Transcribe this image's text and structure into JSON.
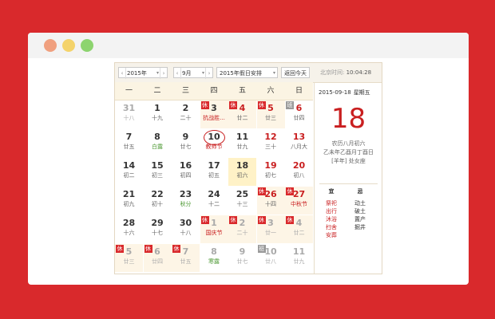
{
  "toolbar": {
    "prev_arrow": "‹",
    "next_arrow": "›",
    "year": "2015年",
    "month": "9月",
    "holiday": "2015年假日安排",
    "today_button": "返回今天",
    "clock_label": "北京时间:",
    "clock_time": "10:04:28",
    "dropdown_arrow": "▾"
  },
  "weekdays": [
    "一",
    "二",
    "三",
    "四",
    "五",
    "六",
    "日"
  ],
  "weeks": [
    [
      {
        "d": "31",
        "l": "十八",
        "other": true
      },
      {
        "d": "1",
        "l": "十九"
      },
      {
        "d": "2",
        "l": "二十"
      },
      {
        "d": "3",
        "l": "抗战胜...",
        "badge": "休",
        "red": true,
        "hol": true
      },
      {
        "d": "4",
        "l": "廿二",
        "badge": "休",
        "hol": true,
        "wkd": true
      },
      {
        "d": "5",
        "l": "廿三",
        "badge": "休",
        "hol": true,
        "wkd": true
      },
      {
        "d": "6",
        "l": "廿四",
        "badge": "班",
        "wkd": true
      }
    ],
    [
      {
        "d": "7",
        "l": "廿五"
      },
      {
        "d": "8",
        "l": "白露",
        "green": true
      },
      {
        "d": "9",
        "l": "廿七"
      },
      {
        "d": "10",
        "l": "教师节",
        "red": true,
        "ring": true
      },
      {
        "d": "11",
        "l": "廿九"
      },
      {
        "d": "12",
        "l": "三十",
        "wkd": true
      },
      {
        "d": "13",
        "l": "八月大",
        "wkd": true
      }
    ],
    [
      {
        "d": "14",
        "l": "初二"
      },
      {
        "d": "15",
        "l": "初三"
      },
      {
        "d": "16",
        "l": "初四"
      },
      {
        "d": "17",
        "l": "初五"
      },
      {
        "d": "18",
        "l": "初六",
        "sel": true
      },
      {
        "d": "19",
        "l": "初七",
        "wkd": true
      },
      {
        "d": "20",
        "l": "初八",
        "wkd": true
      }
    ],
    [
      {
        "d": "21",
        "l": "初九"
      },
      {
        "d": "22",
        "l": "初十"
      },
      {
        "d": "23",
        "l": "秋分",
        "green": true
      },
      {
        "d": "24",
        "l": "十二"
      },
      {
        "d": "25",
        "l": "十三"
      },
      {
        "d": "26",
        "l": "十四",
        "badge": "休",
        "hol": true,
        "wkd": true
      },
      {
        "d": "27",
        "l": "中秋节",
        "badge": "休",
        "hol": true,
        "wkd": true,
        "red": true
      }
    ],
    [
      {
        "d": "28",
        "l": "十六"
      },
      {
        "d": "29",
        "l": "十七"
      },
      {
        "d": "30",
        "l": "十八"
      },
      {
        "d": "1",
        "l": "国庆节",
        "badge": "休",
        "hol": true,
        "other": true,
        "red": true
      },
      {
        "d": "2",
        "l": "二十",
        "badge": "休",
        "hol": true,
        "other": true
      },
      {
        "d": "3",
        "l": "廿一",
        "badge": "休",
        "hol": true,
        "other": true
      },
      {
        "d": "4",
        "l": "廿二",
        "badge": "休",
        "hol": true,
        "other": true
      }
    ],
    [
      {
        "d": "5",
        "l": "廿三",
        "badge": "休",
        "hol": true,
        "other": true
      },
      {
        "d": "6",
        "l": "廿四",
        "badge": "休",
        "hol": true,
        "other": true
      },
      {
        "d": "7",
        "l": "廿五",
        "badge": "休",
        "hol": true,
        "other": true
      },
      {
        "d": "8",
        "l": "寒露",
        "other": true,
        "green": true
      },
      {
        "d": "9",
        "l": "廿七",
        "other": true
      },
      {
        "d": "10",
        "l": "廿八",
        "badge": "班",
        "other": true
      },
      {
        "d": "11",
        "l": "廿九",
        "other": true
      }
    ]
  ],
  "side": {
    "date": "2015-09-18",
    "weekday": "星期五",
    "day": "18",
    "lunar_line1": "农历八月初六",
    "lunar_line2": "乙未年乙酉月丁酉日",
    "lunar_line3": "[羊年] 处女座",
    "yi_title": "宜",
    "yi_items": [
      "祭祀",
      "出行",
      "沐浴",
      "扫舍",
      "安葬"
    ],
    "ji_title": "忌",
    "ji_items": [
      "动土",
      "破土",
      "置产",
      "掘井"
    ]
  }
}
